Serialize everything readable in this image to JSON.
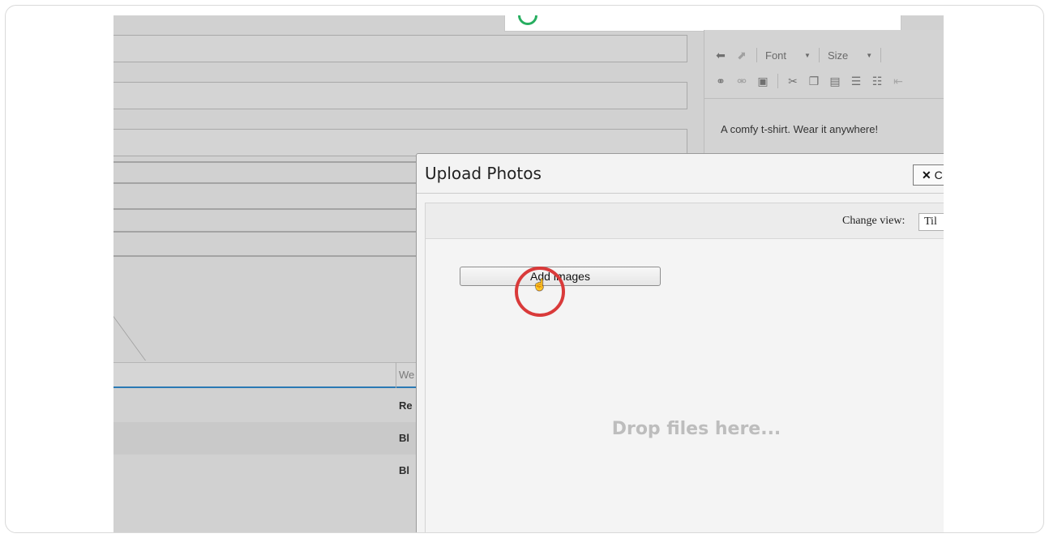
{
  "editor": {
    "font_label": "Font",
    "size_label": "Size",
    "content_text": "A comfy t-shirt. Wear it anywhere!"
  },
  "background_table": {
    "header_partial": "We",
    "rows": [
      "Re",
      "Bl",
      "Bl"
    ]
  },
  "modal": {
    "title": "Upload Photos",
    "close_label": "C",
    "change_view_label": "Change view:",
    "view_select_value": "Til",
    "add_images_label": "Add images",
    "drop_hint": "Drop files here..."
  },
  "colors": {
    "highlight": "#d93a3a",
    "success": "#27ae60",
    "table_accent": "#2a7ab4"
  }
}
